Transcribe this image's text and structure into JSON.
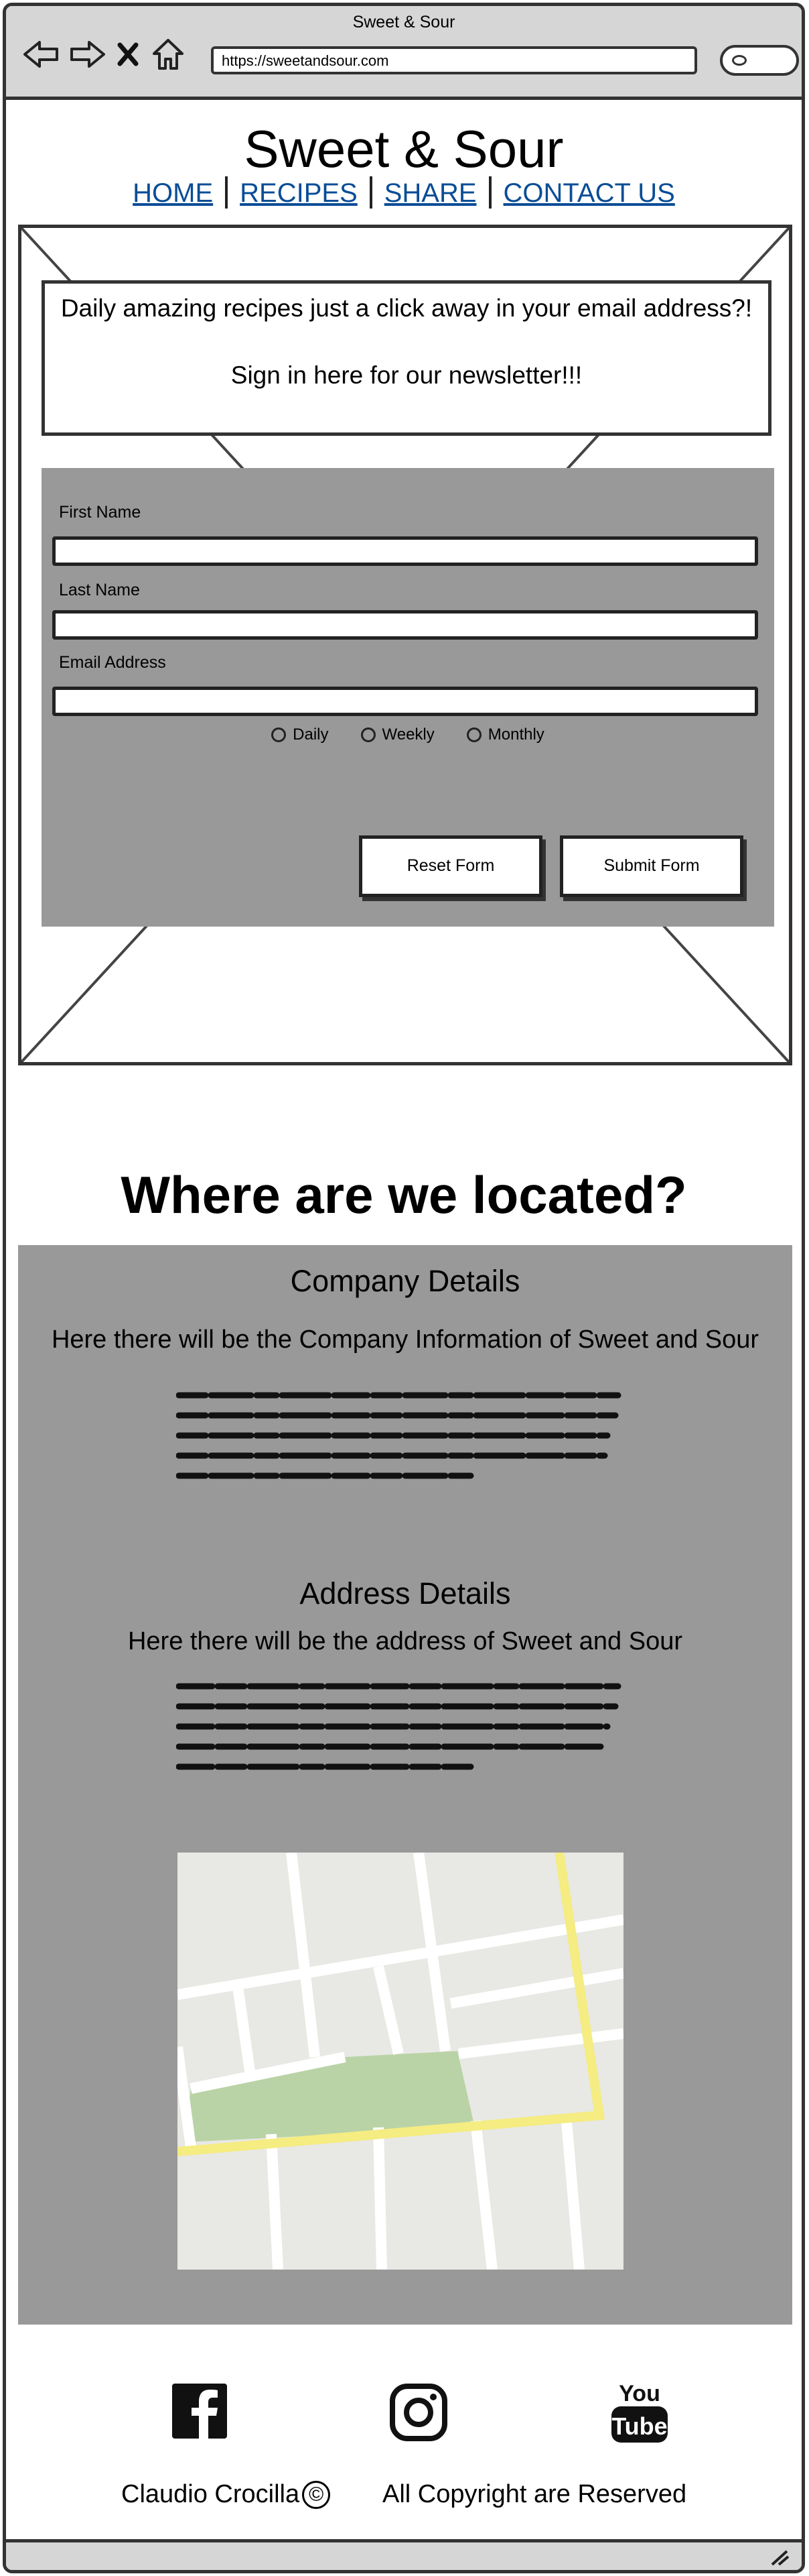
{
  "browser": {
    "window_title": "Sweet & Sour",
    "url": "https://sweetandsour.com",
    "icons": [
      "back-arrow-icon",
      "forward-arrow-icon",
      "close-icon",
      "home-icon",
      "search-icon",
      "resize-grip-icon"
    ]
  },
  "header": {
    "site_title": "Sweet & Sour",
    "nav": [
      "HOME",
      "RECIPES",
      "SHARE",
      "CONTACT US"
    ]
  },
  "newsletter": {
    "promo_line1": "Daily amazing recipes just a click away in your email address?!",
    "promo_line2": "Sign in here for our newsletter!!!",
    "fields": {
      "first_name": "First Name",
      "last_name": "Last Name",
      "email": "Email Address"
    },
    "frequency_options": [
      "Daily",
      "Weekly",
      "Monthly"
    ],
    "reset_label": "Reset Form",
    "submit_label": "Submit Form"
  },
  "location": {
    "heading": "Where are we located?",
    "company_title": "Company Details",
    "company_text": "Here there will be the Company Information of Sweet and Sour",
    "address_title": "Address Details",
    "address_text": "Here there will be the address of Sweet and Sour"
  },
  "footer": {
    "author": "Claudio Crocilla",
    "copyright_symbol": "©",
    "rights": "All Copyright are Reserved",
    "social_icons": [
      "facebook-icon",
      "instagram-icon",
      "youtube-icon"
    ]
  },
  "colors": {
    "panel_gray": "#999999",
    "chrome_gray": "#d6d6d6",
    "link_blue": "#0a4d96",
    "map_road_yellow": "#f5ec82",
    "map_park_green": "#b9d3a6"
  }
}
